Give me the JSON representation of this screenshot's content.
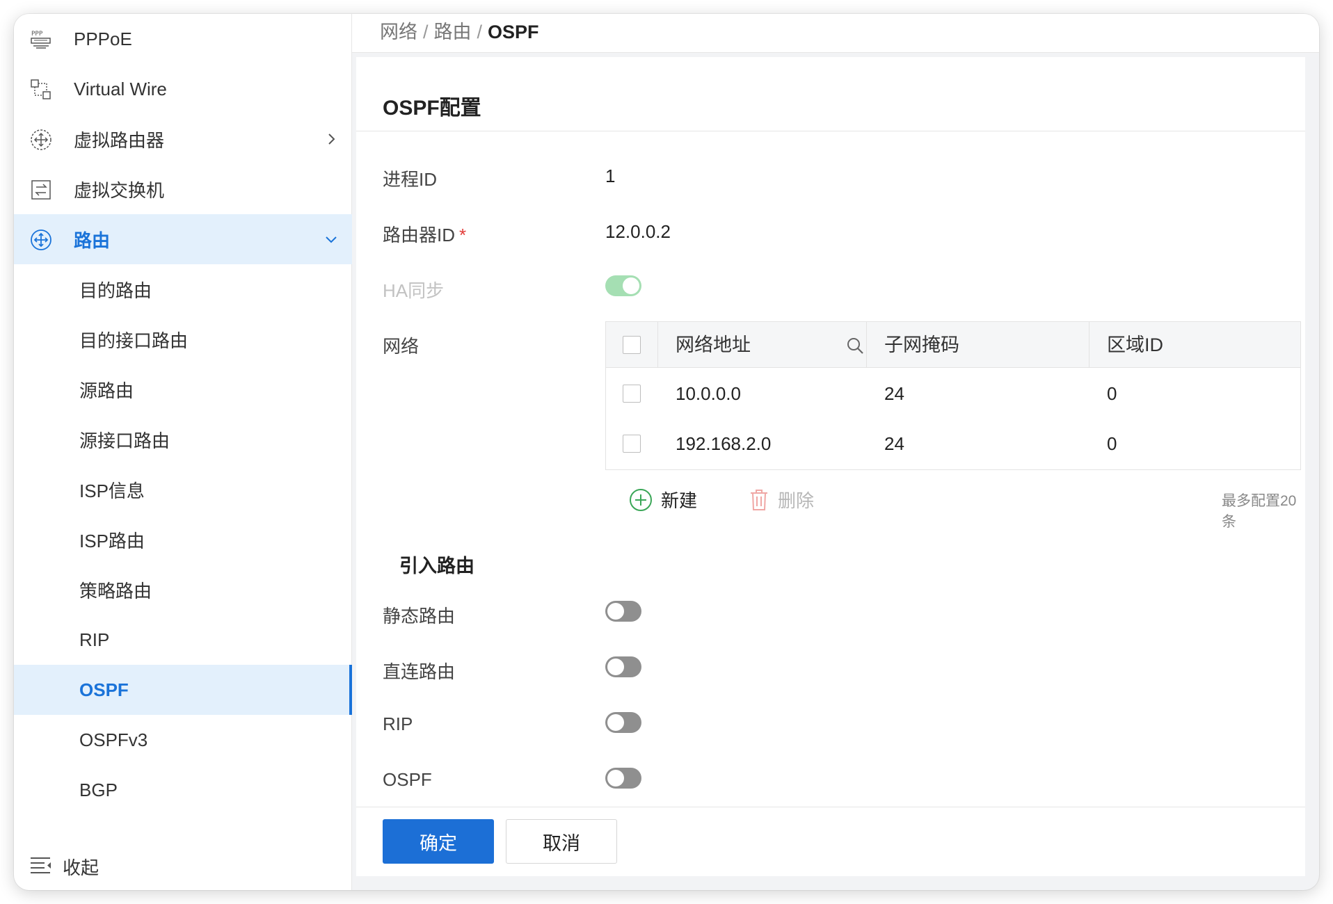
{
  "sidebar": {
    "top_items": [
      {
        "label": "PPPoE",
        "icon": "pppoe-icon"
      },
      {
        "label": "Virtual Wire",
        "icon": "virtual-wire-icon"
      },
      {
        "label": "虚拟路由器",
        "icon": "virtual-router-icon"
      },
      {
        "label": "虚拟交换机",
        "icon": "virtual-switch-icon"
      },
      {
        "label": "路由",
        "icon": "routing-icon"
      }
    ],
    "sub_items": [
      "目的路由",
      "目的接口路由",
      "源路由",
      "源接口路由",
      "ISP信息",
      "ISP路由",
      "策略路由",
      "RIP",
      "OSPF",
      "OSPFv3",
      "BGP"
    ],
    "selected": "OSPF",
    "collapse_label": "收起"
  },
  "breadcrumb": {
    "items": [
      "网络",
      "路由"
    ],
    "current": "OSPF",
    "separator": "/"
  },
  "card": {
    "title": "OSPF配置",
    "process_id_label": "进程ID",
    "process_id_value": "1",
    "router_id_label": "路由器ID",
    "router_id_required": "*",
    "router_id_value": "12.0.0.2",
    "ha_sync_label": "HA同步",
    "ha_sync_on": true,
    "network_label": "网络",
    "table": {
      "columns": [
        "网络地址",
        "子网掩码",
        "区域ID"
      ],
      "rows": [
        {
          "address": "10.0.0.0",
          "mask": "24",
          "area": "0"
        },
        {
          "address": "192.168.2.0",
          "mask": "24",
          "area": "0"
        }
      ]
    },
    "add_label": "新建",
    "delete_label": "删除",
    "max_note": "最多配置20条",
    "redistribute_title": "引入路由",
    "redistribute": [
      {
        "label": "静态路由",
        "on": false
      },
      {
        "label": "直连路由",
        "on": false
      },
      {
        "label": "RIP",
        "on": false
      },
      {
        "label": "OSPF",
        "on": false
      }
    ]
  },
  "footer": {
    "confirm_label": "确定",
    "cancel_label": "取消"
  },
  "colors": {
    "accent": "#1a73d9",
    "primary_button": "#1c6fd6",
    "toggle_on": "#a5dfb3",
    "toggle_off": "#8f8f8f",
    "required": "#e23c39"
  }
}
